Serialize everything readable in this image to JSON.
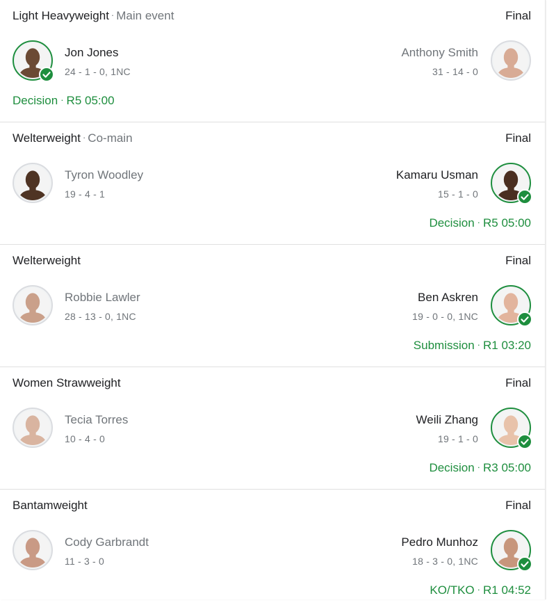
{
  "fights": [
    {
      "division": "Light Heavyweight",
      "subtitle": "Main event",
      "status": "Final",
      "winner_side": "left",
      "left": {
        "name": "Jon Jones",
        "record": "24 - 1 - 0, 1NC",
        "skin": "#6b4a34"
      },
      "right": {
        "name": "Anthony Smith",
        "record": "31 - 14 - 0",
        "skin": "#d8ab95"
      },
      "method": "Decision",
      "round_time": "R5 05:00"
    },
    {
      "division": "Welterweight",
      "subtitle": "Co-main",
      "status": "Final",
      "winner_side": "right",
      "left": {
        "name": "Tyron Woodley",
        "record": "19 - 4 - 1",
        "skin": "#4f3424"
      },
      "right": {
        "name": "Kamaru Usman",
        "record": "15 - 1 - 0",
        "skin": "#4a2e20"
      },
      "method": "Decision",
      "round_time": "R5 05:00"
    },
    {
      "division": "Welterweight",
      "subtitle": "",
      "status": "Final",
      "winner_side": "right",
      "left": {
        "name": "Robbie Lawler",
        "record": "28 - 13 - 0, 1NC",
        "skin": "#caa08a"
      },
      "right": {
        "name": "Ben Askren",
        "record": "19 - 0 - 0, 1NC",
        "skin": "#e2b49d"
      },
      "method": "Submission",
      "round_time": "R1 03:20"
    },
    {
      "division": "Women Strawweight",
      "subtitle": "",
      "status": "Final",
      "winner_side": "right",
      "left": {
        "name": "Tecia Torres",
        "record": "10 - 4 - 0",
        "skin": "#d9b4a0"
      },
      "right": {
        "name": "Weili Zhang",
        "record": "19 - 1 - 0",
        "skin": "#e8c2aa"
      },
      "method": "Decision",
      "round_time": "R3 05:00"
    },
    {
      "division": "Bantamweight",
      "subtitle": "",
      "status": "Final",
      "winner_side": "right",
      "left": {
        "name": "Cody Garbrandt",
        "record": "11 - 3 - 0",
        "skin": "#c99a85"
      },
      "right": {
        "name": "Pedro Munhoz",
        "record": "18 - 3 - 0, 1NC",
        "skin": "#c7967c"
      },
      "method": "KO/TKO",
      "round_time": "R1 04:52"
    }
  ],
  "colors": {
    "win_green": "#1e8e3e",
    "muted": "#70757a",
    "text": "#202124"
  },
  "icons": {
    "winner_badge": "check-icon",
    "fighter_photo": "avatar"
  }
}
